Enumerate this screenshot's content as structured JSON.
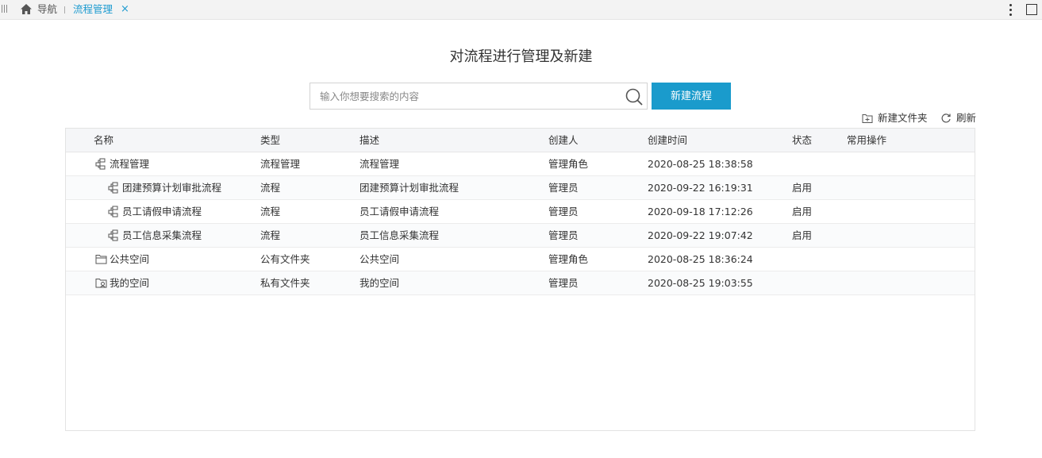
{
  "tabs": {
    "nav_label": "导航",
    "active_label": "流程管理",
    "close_glyph": "×"
  },
  "page": {
    "title": "对流程进行管理及新建"
  },
  "search": {
    "placeholder": "输入你想要搜索的内容",
    "value": ""
  },
  "actions": {
    "new_flow": "新建流程",
    "new_folder": "新建文件夹",
    "refresh": "刷新"
  },
  "table": {
    "columns": [
      "名称",
      "类型",
      "描述",
      "创建人",
      "创建时间",
      "状态",
      "常用操作"
    ],
    "rows": [
      {
        "icon": "flow-group-icon",
        "indent": 0,
        "name": "流程管理",
        "type": "流程管理",
        "desc": "流程管理",
        "creator": "管理角色",
        "created": "2020-08-25 18:38:58",
        "status": ""
      },
      {
        "icon": "flow-icon",
        "indent": 1,
        "name": "团建预算计划审批流程",
        "type": "流程",
        "desc": "团建预算计划审批流程",
        "creator": "管理员",
        "created": "2020-09-22 16:19:31",
        "status": "启用"
      },
      {
        "icon": "flow-icon",
        "indent": 1,
        "name": "员工请假申请流程",
        "type": "流程",
        "desc": "员工请假申请流程",
        "creator": "管理员",
        "created": "2020-09-18 17:12:26",
        "status": "启用"
      },
      {
        "icon": "flow-icon",
        "indent": 1,
        "name": "员工信息采集流程",
        "type": "流程",
        "desc": "员工信息采集流程",
        "creator": "管理员",
        "created": "2020-09-22 19:07:42",
        "status": "启用"
      },
      {
        "icon": "folder-icon",
        "indent": 0,
        "name": "公共空间",
        "type": "公有文件夹",
        "desc": "公共空间",
        "creator": "管理角色",
        "created": "2020-08-25 18:36:24",
        "status": ""
      },
      {
        "icon": "private-folder-icon",
        "indent": 0,
        "name": "我的空间",
        "type": "私有文件夹",
        "desc": "我的空间",
        "creator": "管理员",
        "created": "2020-08-25 19:03:55",
        "status": ""
      }
    ]
  },
  "colors": {
    "accent": "#1e9bd0",
    "button": "#1a9bcc",
    "header_bg": "#f5f6f8"
  }
}
